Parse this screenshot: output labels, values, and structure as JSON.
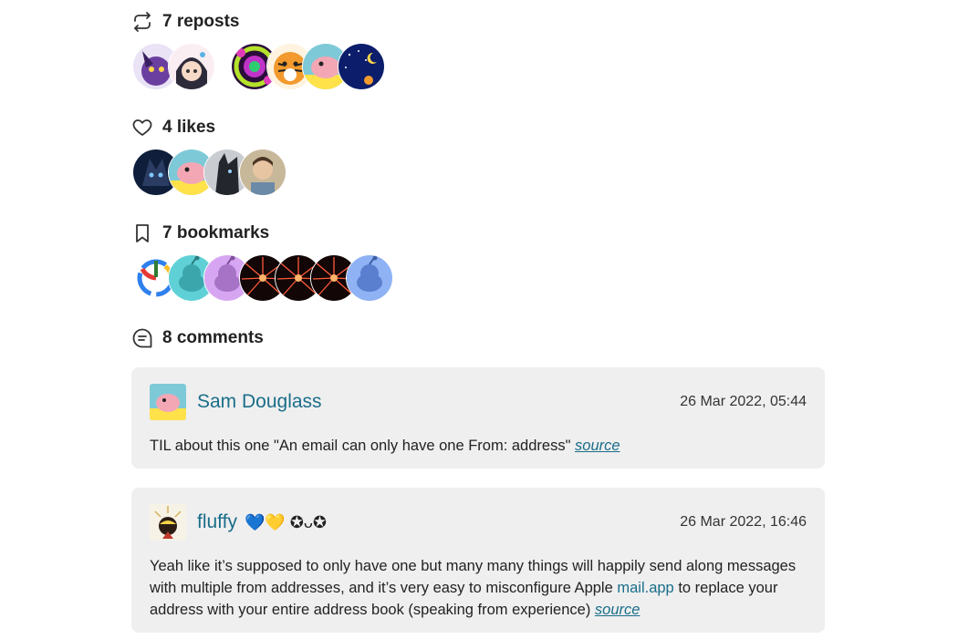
{
  "reposts": {
    "label": "7 reposts",
    "avatars": [
      "purple-character-avatar",
      "girl-drawing-avatar",
      "kaleidoscope-avatar",
      "tiger-avatar",
      "sam-avatar",
      "night-sky-avatar"
    ]
  },
  "likes": {
    "label": "4 likes",
    "avatars": [
      "wolf-avatar",
      "sam-avatar",
      "dark-horse-avatar",
      "man-photo-avatar"
    ]
  },
  "bookmarks": {
    "label": "7 bookmarks",
    "avatars": [
      "power-logo-avatar",
      "teal-robot-avatar",
      "purple-robot-avatar",
      "red-burst-avatar",
      "red-burst-avatar",
      "red-burst-avatar",
      "blue-robot-avatar"
    ]
  },
  "comments": {
    "label": "8 comments",
    "items": [
      {
        "name": "Sam Douglass",
        "date": "26 Mar 2022, 05:44",
        "text": "TIL about this one \"An email can only have one From: address\" ",
        "source_label": "source"
      },
      {
        "name": "fluffy",
        "name_emoji": "💙💛 ✪ᴗ✪",
        "date": "26 Mar 2022, 16:46",
        "text_before": "Yeah like it’s supposed to only have one but many many things will happily send along messages with multiple from addresses, and it’s very easy to misconfigure Apple ",
        "link_label": "mail.app",
        "text_after": " to replace your address with your entire address book (speaking from experience) ",
        "source_label": "source"
      }
    ]
  },
  "colors": {
    "link": "#1a6e8a",
    "card": "#efefef"
  }
}
